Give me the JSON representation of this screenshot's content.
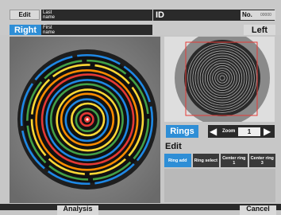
{
  "header": {
    "edit_tab": "Edit",
    "last_name_label": "Last\nname",
    "first_name_label": "First\nname",
    "eye_selected": "Right",
    "id_label": "ID",
    "no_label": "No.",
    "no_value": "00000",
    "eye_other": "Left"
  },
  "controls": {
    "rings_label": "Rings",
    "zoom_label": "Zoom",
    "zoom_value": "1",
    "left_arrow": "◀",
    "right_arrow": "▶"
  },
  "edit": {
    "title": "Edit",
    "buttons": [
      {
        "label": "Ring add",
        "active": true
      },
      {
        "label": "Ring select",
        "active": false
      },
      {
        "label": "Center ring 1",
        "active": false
      },
      {
        "label": "Center ring 3",
        "active": false
      }
    ]
  },
  "toolbar": {
    "analysis_label": "Analysis",
    "cancel_label": "Cancel"
  },
  "colors": {
    "accent": "#2e8ed6",
    "dark": "#2a2a2a",
    "ring_colors": [
      "#e53935",
      "#43a047",
      "#fdd835",
      "#1e88e5",
      "#fb8c00"
    ]
  }
}
